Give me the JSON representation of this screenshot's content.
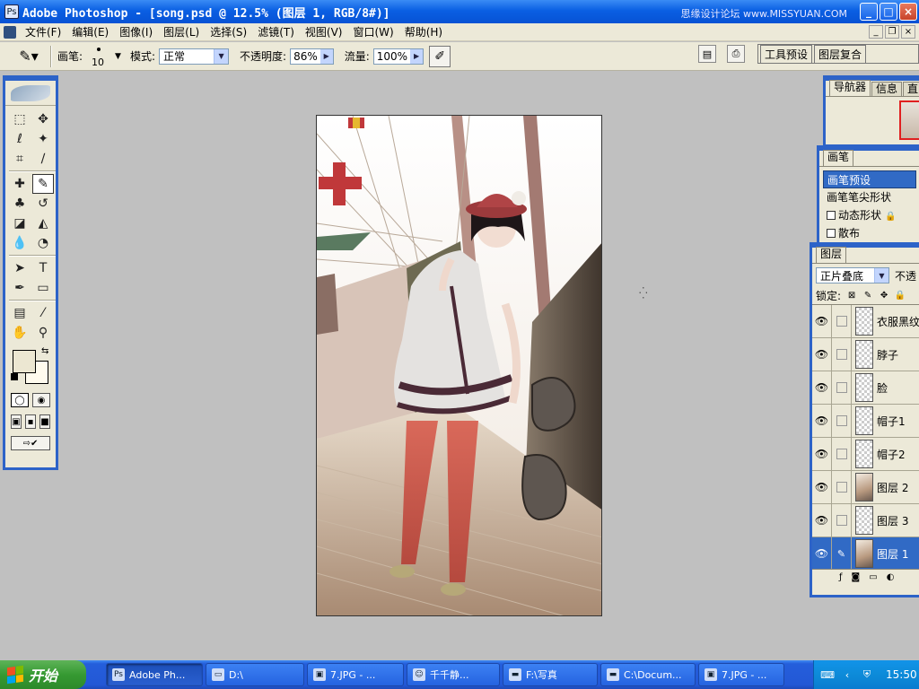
{
  "window": {
    "title": "Adobe Photoshop - [song.psd @ 12.5% (图层 1, RGB/8#)]",
    "watermark": "思缘设计论坛 www.MISSYUAN.COM"
  },
  "menu": {
    "items": [
      "文件(F)",
      "编辑(E)",
      "图像(I)",
      "图层(L)",
      "选择(S)",
      "滤镜(T)",
      "视图(V)",
      "窗口(W)",
      "帮助(H)"
    ]
  },
  "options": {
    "brush_label": "画笔:",
    "brush_size": "10",
    "mode_label": "模式:",
    "mode_value": "正常",
    "opacity_label": "不透明度:",
    "opacity_value": "86%",
    "flow_label": "流量:",
    "flow_value": "100%",
    "well_tabs": [
      "工具预设",
      "图层复合"
    ]
  },
  "panels": {
    "navigator_tabs": [
      "导航器",
      "信息",
      "直"
    ],
    "brushes_tab": "画笔",
    "brush_items": [
      "画笔预设",
      "画笔笔尖形状",
      "动态形状",
      "散布"
    ],
    "layers_tab": "图层",
    "blend_mode": "正片叠底",
    "opacity_label": "不透",
    "lock_label": "锁定:",
    "layers": [
      {
        "name": "衣服黑纹",
        "selected": false
      },
      {
        "name": "脖子",
        "selected": false
      },
      {
        "name": "脸",
        "selected": false
      },
      {
        "name": "帽子1",
        "selected": false
      },
      {
        "name": "帽子2",
        "selected": false
      },
      {
        "name": "图层 2",
        "selected": false
      },
      {
        "name": "图层 3",
        "selected": false
      },
      {
        "name": "图层 1",
        "selected": true
      }
    ]
  },
  "taskbar": {
    "start_label": "开始",
    "tasks": [
      "Adobe Ph...",
      "D:\\",
      "7.JPG - ...",
      "千千静...",
      "F:\\写真",
      "C:\\Docum...",
      "7.JPG - ..."
    ],
    "clock": "15:50"
  },
  "colors": {
    "foreground": "#ece7d2",
    "background": "#fffbee",
    "accent": "#316ac5"
  }
}
